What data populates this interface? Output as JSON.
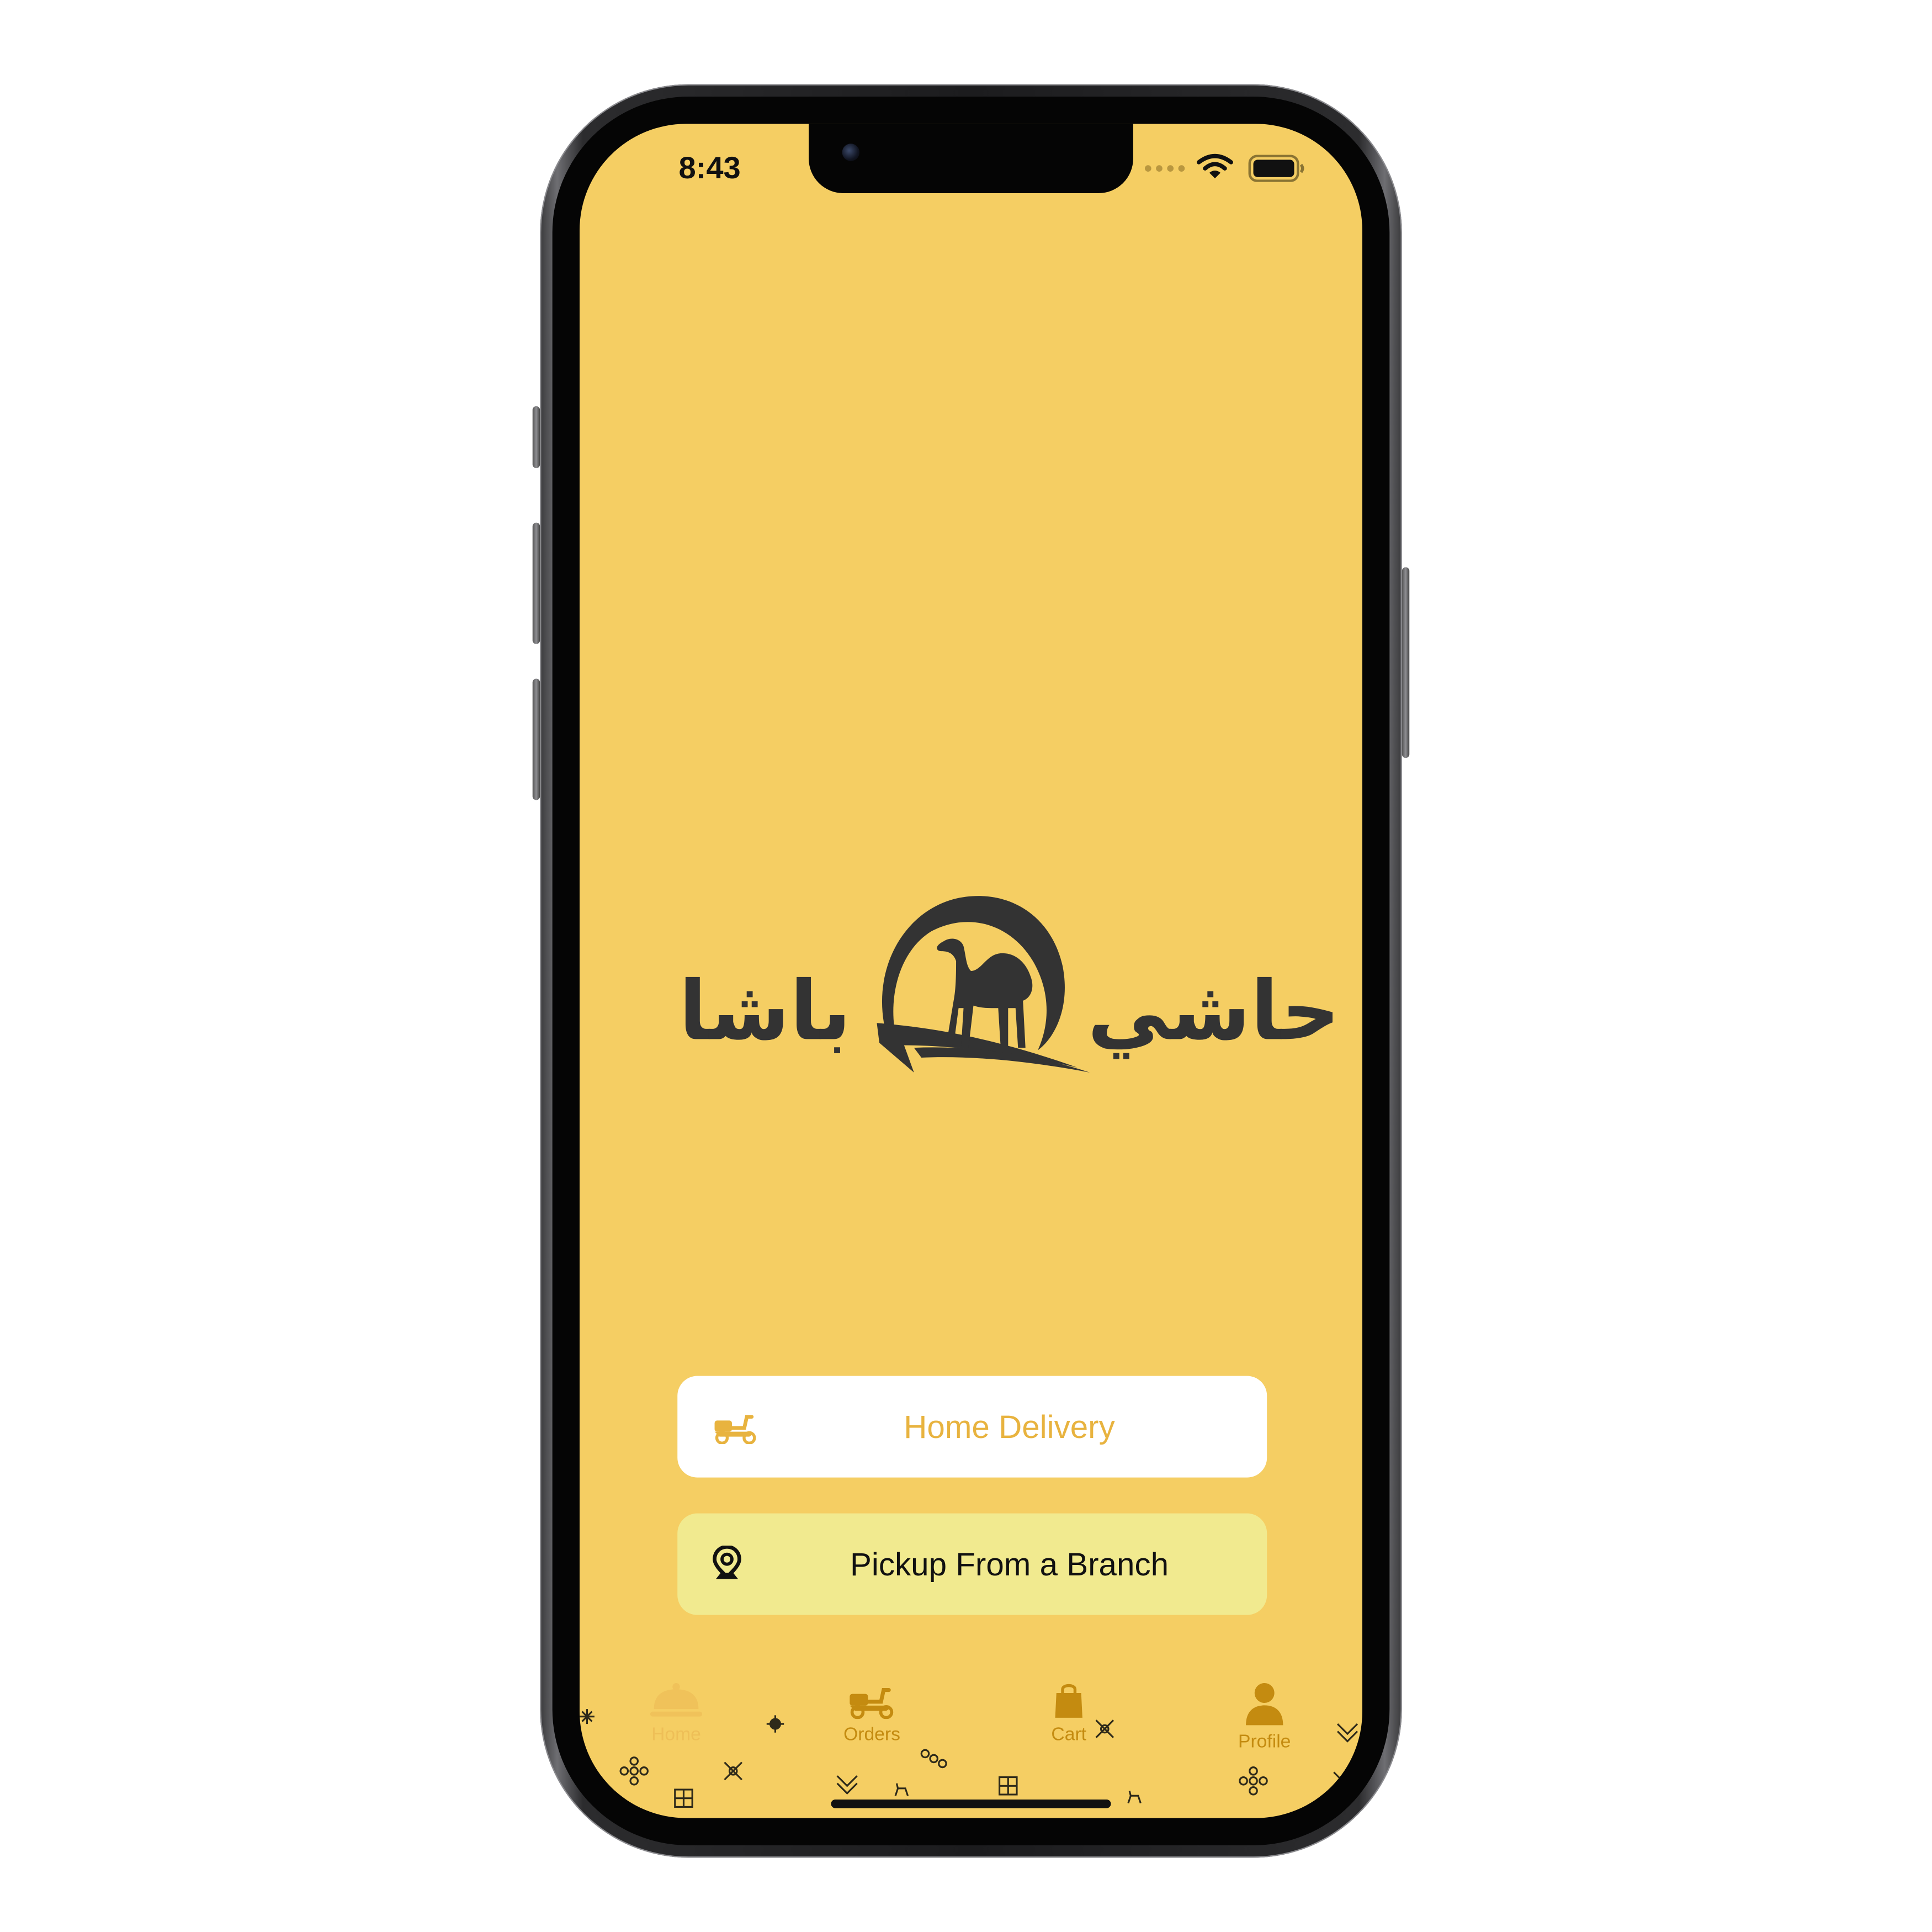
{
  "status_bar": {
    "time": "8:43",
    "signal_icon": "signal-dots-icon",
    "wifi_icon": "wifi-icon",
    "battery_icon": "battery-icon"
  },
  "brand": {
    "logo_icon": "camel-sun-logo-icon",
    "word_right": "حاشي",
    "word_left": "باشا",
    "text_color": "#333333"
  },
  "actions": {
    "home_delivery": {
      "label": "Home Delivery",
      "icon": "scooter-icon"
    },
    "pickup": {
      "label": "Pickup From a Branch",
      "icon": "location-pin-icon"
    }
  },
  "tabbar": {
    "items": [
      {
        "label": "Home",
        "icon": "food-cloche-icon",
        "state": "active"
      },
      {
        "label": "Orders",
        "icon": "scooter-icon",
        "state": "inactive"
      },
      {
        "label": "Cart",
        "icon": "shopping-bag-icon",
        "state": "inactive"
      },
      {
        "label": "Profile",
        "icon": "person-icon",
        "state": "inactive"
      }
    ]
  },
  "colors": {
    "screen_background": "#f5ce63",
    "accent_gold": "#e8b33f",
    "tab_active": "#e9b84a",
    "tab_inactive": "#c48b10",
    "pickup_background": "#f1ea8f",
    "home_delivery_background": "#ffffff"
  }
}
